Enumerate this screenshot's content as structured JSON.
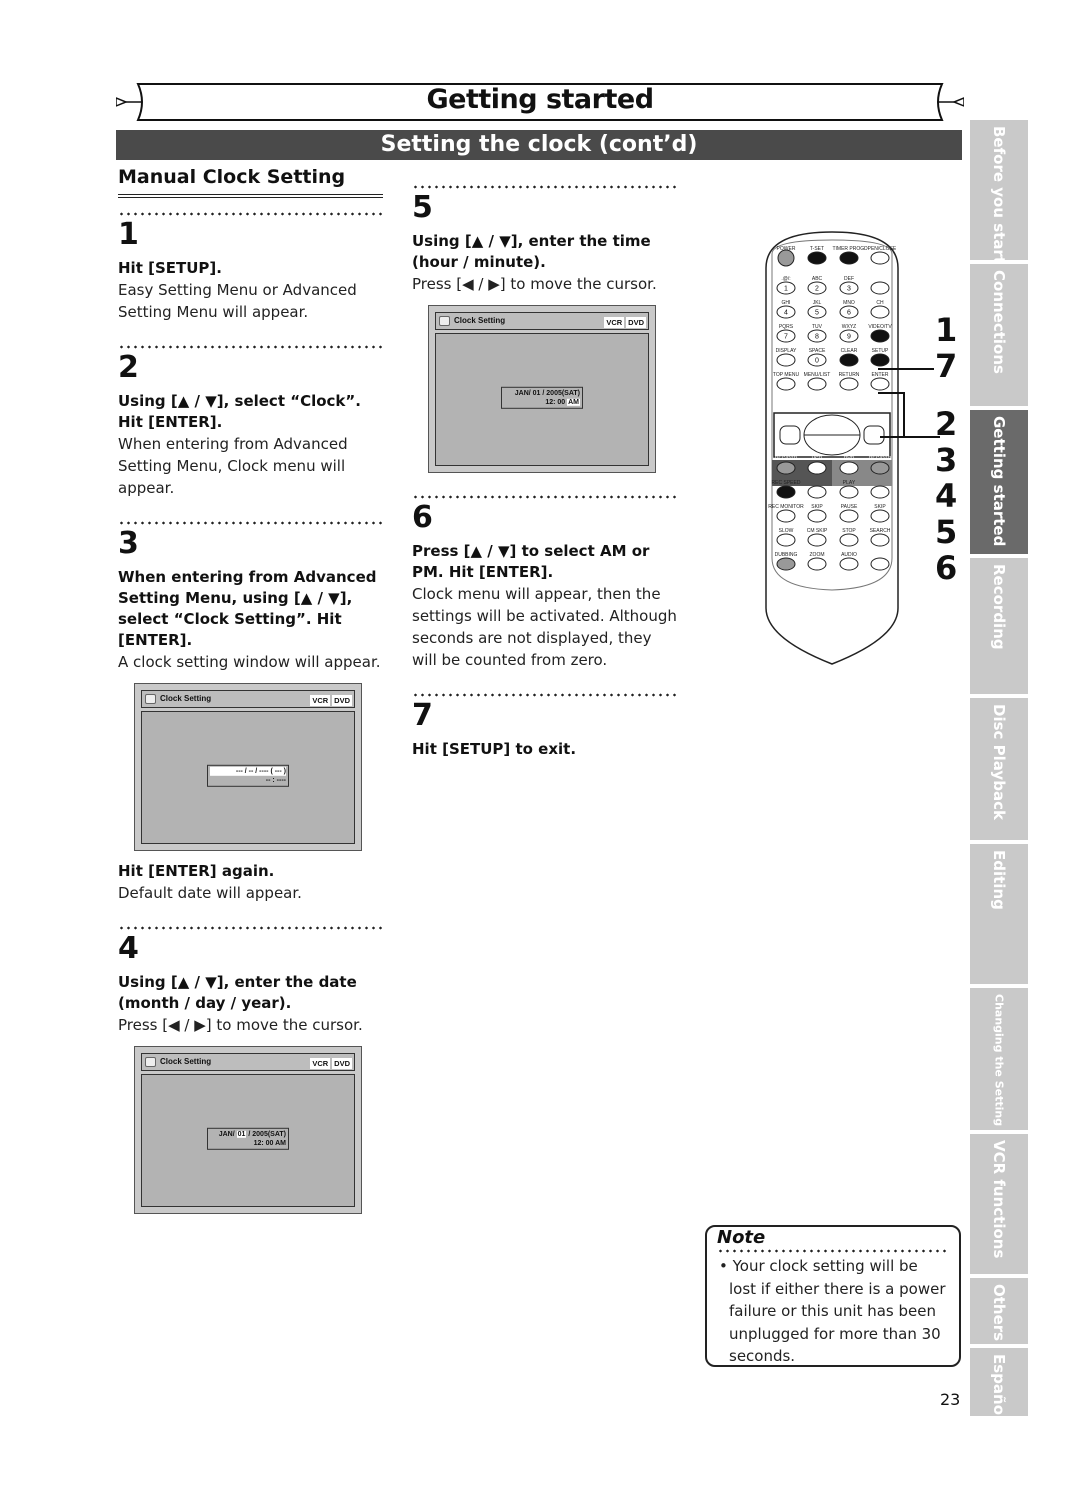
{
  "header": {
    "chapter_title": "Getting started",
    "section_title": "Setting the clock (cont’d)"
  },
  "left_column": {
    "subheading": "Manual Clock Setting",
    "steps": [
      {
        "num": "1",
        "bold": "Hit [SETUP].",
        "text": "Easy Setting Menu or Advanced Setting Menu will appear."
      },
      {
        "num": "2",
        "bold": "Using [▲ / ▼], select “Clock”. Hit [ENTER].",
        "text": "When entering from Advanced Setting Menu, Clock menu will appear."
      },
      {
        "num": "3",
        "bold": "When entering from Advanced Setting Menu, using [▲ / ▼], select “Clock Setting”. Hit [ENTER].",
        "text": "A clock setting window will appear.",
        "bold2": "Hit [ENTER] again.",
        "text2": "Default date will appear."
      },
      {
        "num": "4",
        "bold": "Using [▲ / ▼], enter the date (month / day / year).",
        "text": "Press [◀ / ▶] to move the cursor."
      }
    ]
  },
  "mid_column": {
    "steps": [
      {
        "num": "5",
        "bold": "Using [▲ / ▼], enter the time (hour / minute).",
        "text": "Press [◀ / ▶] to move the cursor."
      },
      {
        "num": "6",
        "bold": "Press [▲ / ▼] to select AM or PM. Hit [ENTER].",
        "text": "Clock menu will appear, then the settings will be activated. Although seconds are not displayed, they will be counted from zero."
      },
      {
        "num": "7",
        "bold": "Hit [SETUP] to exit."
      }
    ]
  },
  "osd_screens": [
    {
      "title": "Clock Setting",
      "tags": [
        "VCR",
        "DVD"
      ],
      "date_pre": "--- / -- / ---- ( --- )",
      "date_hl": "",
      "date_post": "",
      "time_pre": "-- : ----",
      "time_hl": ""
    },
    {
      "title": "Clock Setting",
      "tags": [
        "VCR",
        "DVD"
      ],
      "date_pre": "JAN/ ",
      "date_hl": "01",
      "date_post": " / 2005(SAT)",
      "time_pre": "12: 00  AM",
      "time_hl": ""
    },
    {
      "title": "Clock Setting",
      "tags": [
        "VCR",
        "DVD"
      ],
      "date_pre": "JAN/ 01 / 2005(SAT)",
      "date_hl": "",
      "date_post": "",
      "time_pre": "12: 00 ",
      "time_hl": "AM"
    }
  ],
  "remote": {
    "rows": [
      [
        "POWER",
        "T-SET",
        "TIMER PROG.",
        "OPEN/CLOSE"
      ],
      [
        ".@/:",
        "ABC",
        "DEF",
        ""
      ],
      [
        "GHI",
        "JKL",
        "MNO",
        "CH"
      ],
      [
        "PQRS",
        "TUV",
        "WXYZ",
        "VIDEO/TV"
      ],
      [
        "DISPLAY",
        "SPACE",
        "CLEAR",
        "SETUP"
      ],
      [
        "TOP MENU",
        "MENU/LIST",
        "RETURN",
        "ENTER"
      ],
      [
        "REC/OTR",
        "VCR",
        "DVD",
        "REC/OTR"
      ],
      [
        "REC SPEED",
        "",
        "PLAY",
        ""
      ],
      [
        "REC MONITOR",
        "SKIP",
        "PAUSE",
        "SKIP"
      ],
      [
        "SLOW",
        "CM SKIP",
        "STOP",
        "SEARCH"
      ],
      [
        "DUBBING",
        "ZOOM",
        "AUDIO",
        ""
      ]
    ],
    "digits": [
      "1",
      "2",
      "3",
      "4",
      "5",
      "6",
      "7",
      "8",
      "9",
      "0"
    ],
    "callouts": [
      "1",
      "7",
      "2",
      "3",
      "4",
      "5",
      "6"
    ]
  },
  "side_tabs": [
    {
      "label": "Before you start",
      "active": false
    },
    {
      "label": "Connections",
      "active": false
    },
    {
      "label": "Getting started",
      "active": true
    },
    {
      "label": "Recording",
      "active": false
    },
    {
      "label": "Disc Playback",
      "active": false
    },
    {
      "label": "Editing",
      "active": false
    },
    {
      "label": "Changing the Setting menu",
      "active": false
    },
    {
      "label": "VCR functions",
      "active": false
    },
    {
      "label": "Others",
      "active": false
    },
    {
      "label": "Español",
      "active": false
    }
  ],
  "note": {
    "heading": "Note",
    "text": "• Your clock setting will be lost if either there is a power failure or this unit has been unplugged for more than 30 seconds."
  },
  "page_number": "23"
}
